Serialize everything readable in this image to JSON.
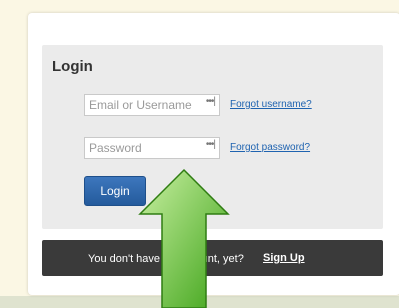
{
  "login": {
    "title": "Login",
    "username_placeholder": "Email or Username",
    "password_placeholder": "Password",
    "forgot_username": "Forgot username?",
    "forgot_password": "Forgot password?",
    "button_label": "Login"
  },
  "signup": {
    "prompt": "You don't have an account, yet?",
    "link_label": "Sign Up"
  },
  "overlay": {
    "arrow_color": "#6cc63c"
  }
}
